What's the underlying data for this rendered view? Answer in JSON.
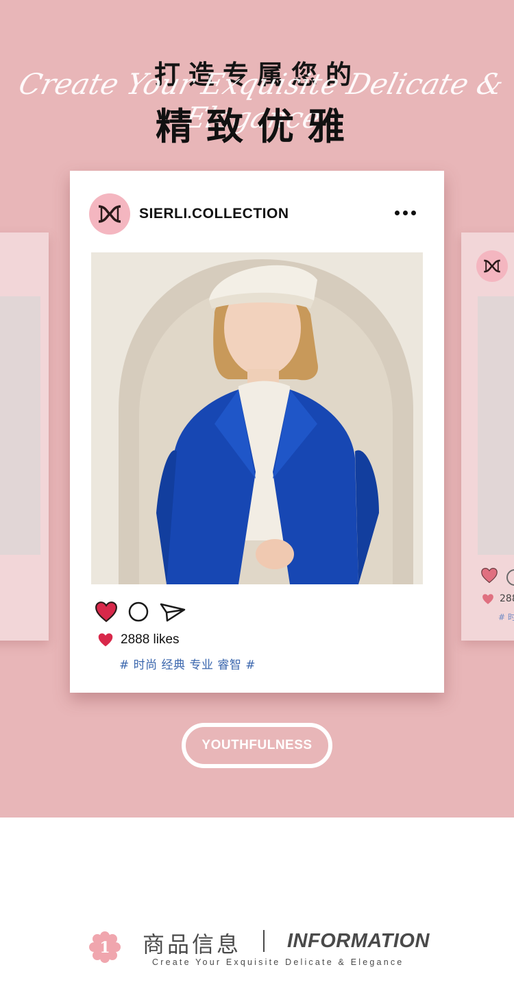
{
  "colors": {
    "background_pink": "#e8b6b8",
    "side_card": "#f2d6d8",
    "avatar_pink": "#f4b6c0",
    "heart_red": "#d8284a",
    "tag_blue": "#3a66ad",
    "footer_text": "#4a4a4a"
  },
  "hero": {
    "title_line1": "打造专属您的",
    "script_text": "Create Your Exquisite Delicate & Elegance",
    "title_line2": "精致优雅"
  },
  "post": {
    "username": "SIERLI.COLLECTION",
    "icons": [
      "brand-logo-icon",
      "more-icon",
      "heart-icon",
      "comment-icon",
      "share-icon"
    ],
    "likes": "2888 likes",
    "tags": "# 时尚 经典 专业 睿智 #"
  },
  "side_post": {
    "likes": "288",
    "tag": "# 时"
  },
  "pill": {
    "label": "YOUTHFULNESS"
  },
  "section": {
    "badge_number": "1",
    "title_cn": "商品信息",
    "title_en": "INFORMATION",
    "subtitle": "Create Your Exquisite Delicate & Elegance"
  }
}
